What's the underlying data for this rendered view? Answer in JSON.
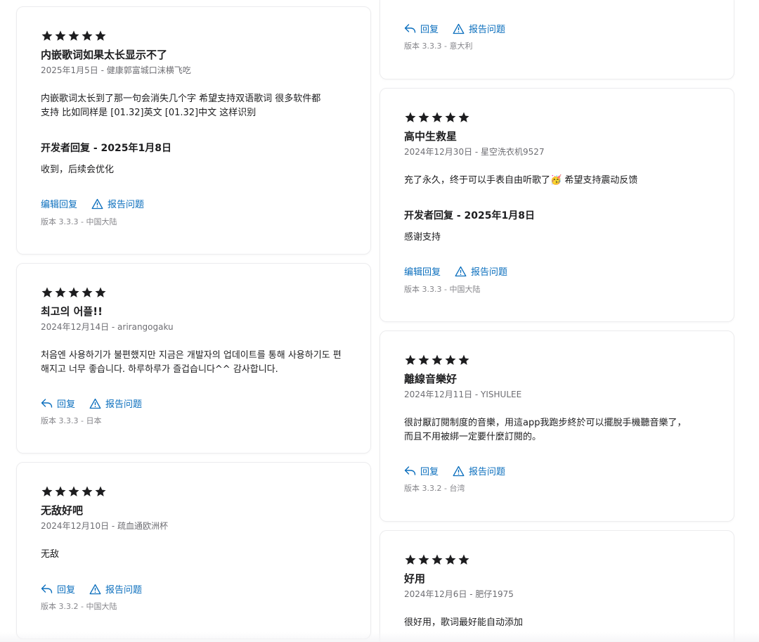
{
  "icons": {
    "star": "star-icon",
    "reply": "reply-arrow-icon",
    "report": "warning-triangle-icon"
  },
  "colors": {
    "link": "#0a6ebd",
    "meta": "#6e6e73",
    "text": "#1d1d1f"
  },
  "left": {
    "c1": {
      "rating": 5,
      "title": "内嵌歌词如果太长显示不了",
      "meta": "2025年1月5日 - 健康郭富城口沫横飞吃",
      "body_l1": "内嵌歌词太长到了那一句会消失几个字 希望支持双语歌词 很多软件都",
      "body_l2": "支持 比如同样是 [01.32]英文 [01.32]中文 这样识别",
      "dev_title": "开发者回复 - 2025年1月8日",
      "dev_body": "收到，后续会优化",
      "edit_reply": "编辑回复",
      "report": "报告问题",
      "version": "版本 3.3.3 - 中国大陆"
    },
    "c2": {
      "rating": 5,
      "title": "최고의 어플!!",
      "meta": "2024年12月14日 - arirangogaku",
      "body_l1": "처음엔 사용하기가 불편했지만 지금은 개발자의 업데이트를 통해 사용하기도 편",
      "body_l2": "해지고 너무 좋습니다. 하루하루가 즐겁습니다^^ 감사합니다.",
      "reply": "回复",
      "report": "报告问题",
      "version": "版本 3.3.3 - 日本"
    },
    "c3": {
      "rating": 5,
      "title": "无敌好吧",
      "meta": "2024年12月10日 - 疏血通欧洲杯",
      "body_l1": "无敌",
      "reply": "回复",
      "report": "报告问题",
      "version": "版本 3.3.2 - 中国大陆"
    }
  },
  "right": {
    "c0": {
      "reply": "回复",
      "report": "报告问题",
      "version": "版本 3.3.3 - 意大利"
    },
    "c1": {
      "rating": 5,
      "title": "高中生救星",
      "meta": "2024年12月30日 - 星空洗衣机9527",
      "body_l1": "充了永久，终于可以手表自由听歌了🥳 希望支持震动反馈",
      "dev_title": "开发者回复 - 2025年1月8日",
      "dev_body": "感谢支持",
      "edit_reply": "编辑回复",
      "report": "报告问题",
      "version": "版本 3.3.3 - 中国大陆"
    },
    "c2": {
      "rating": 5,
      "title": "離線音樂好",
      "meta": "2024年12月11日 - YISHULEE",
      "body_l1": "很討厭訂閱制度的音樂，用這app我跑步終於可以擺脫手機聽音樂了，",
      "body_l2": "而且不用被綁一定要什麼訂閱的。",
      "reply": "回复",
      "report": "报告问题",
      "version": "版本 3.3.2 - 台湾"
    },
    "c3": {
      "rating": 5,
      "title": "好用",
      "meta": "2024年12月6日 - 肥仔1975",
      "body_l1": "很好用，歌词最好能自动添加"
    }
  }
}
